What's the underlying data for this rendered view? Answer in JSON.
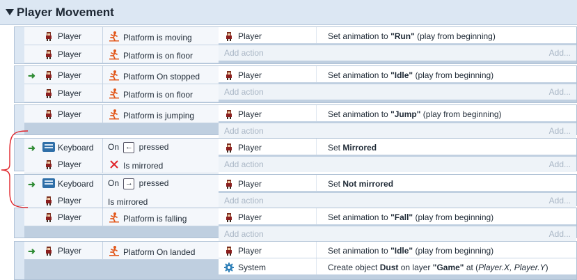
{
  "group": {
    "title": "Player Movement"
  },
  "labels": {
    "add_action": "Add action",
    "add_more": "Add..."
  },
  "events": [
    {
      "conditions": [
        {
          "object": "Player",
          "text": "Platform is moving",
          "icon": "platform-icon"
        },
        {
          "object": "Player",
          "text": "Platform is on floor",
          "icon": "platform-icon"
        }
      ],
      "actions": [
        {
          "object": "Player",
          "pre": "Set animation to ",
          "bold": "\"Run\"",
          "post": " (play from beginning)"
        }
      ]
    },
    {
      "conditions": [
        {
          "object": "Player",
          "text": "Platform On stopped",
          "icon": "platform-icon",
          "trigger": true
        },
        {
          "object": "Player",
          "text": "Platform is on floor",
          "icon": "platform-icon"
        }
      ],
      "actions": [
        {
          "object": "Player",
          "pre": "Set animation to ",
          "bold": "\"Idle\"",
          "post": " (play from beginning)"
        }
      ]
    },
    {
      "conditions": [
        {
          "object": "Player",
          "text": "Platform is jumping",
          "icon": "platform-icon"
        }
      ],
      "actions": [
        {
          "object": "Player",
          "pre": "Set animation to ",
          "bold": "\"Jump\"",
          "post": " (play from beginning)"
        }
      ]
    },
    {
      "conditions": [
        {
          "object": "Keyboard",
          "pre": "On ",
          "key": "←",
          "post": " pressed",
          "trigger": true
        },
        {
          "object": "Player",
          "text": "Is mirrored",
          "icon": "cross-icon"
        }
      ],
      "actions": [
        {
          "object": "Player",
          "pre": "Set ",
          "bold": "Mirrored",
          "post": ""
        }
      ]
    },
    {
      "conditions": [
        {
          "object": "Keyboard",
          "pre": "On ",
          "key": "→",
          "post": " pressed",
          "trigger": true
        },
        {
          "object": "Player",
          "text": "Is mirrored"
        }
      ],
      "actions": [
        {
          "object": "Player",
          "pre": "Set ",
          "bold": "Not mirrored",
          "post": ""
        }
      ]
    },
    {
      "conditions": [
        {
          "object": "Player",
          "text": "Platform is falling",
          "icon": "platform-icon"
        }
      ],
      "actions": [
        {
          "object": "Player",
          "pre": "Set animation to ",
          "bold": "\"Fall\"",
          "post": " (play from beginning)"
        }
      ]
    },
    {
      "conditions": [
        {
          "object": "Player",
          "text": "Platform On landed",
          "icon": "platform-icon",
          "trigger": true
        }
      ],
      "actions": [
        {
          "object": "Player",
          "pre": "Set animation to ",
          "bold": "\"Idle\"",
          "post": " (play from beginning)"
        },
        {
          "object": "System",
          "icon": "gear-icon",
          "pre": "Create object  ",
          "bold": "Dust",
          "post": " on layer ",
          "bold2": "\"Game\"",
          "post2": " at (",
          "ital": "Player.X, Player.Y",
          "post3": ")"
        }
      ]
    }
  ],
  "colors": {
    "trigger_arrow": "#2e8b33",
    "brace": "#e0242a",
    "platform_icon": "#e2581c",
    "cross": "#e0242a",
    "header_bg": "#dce7f3"
  }
}
